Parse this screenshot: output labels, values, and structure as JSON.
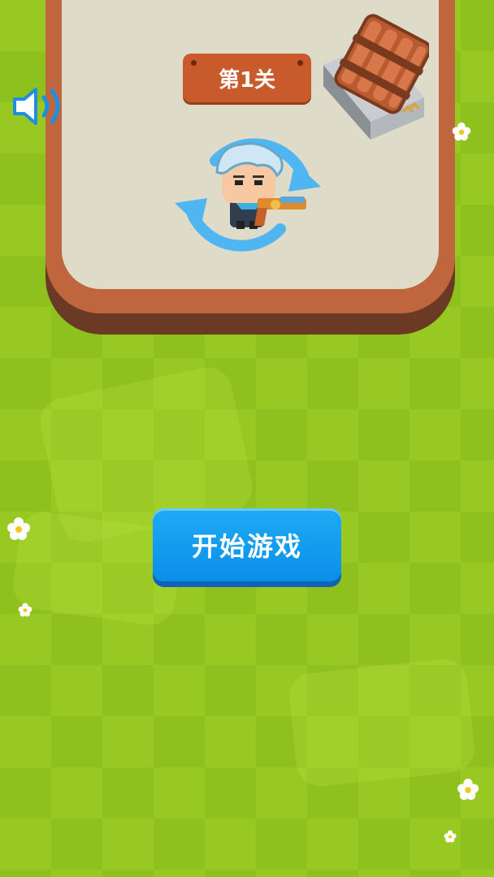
{
  "level": {
    "label": "第1关"
  },
  "start_button": {
    "label": "开始游戏"
  },
  "sound": {
    "icon": "speaker-icon",
    "state": "on"
  },
  "player": {
    "icon": "gunner-hero-icon",
    "weapon": "revolver-icon",
    "indicator": "rotate-arrows-icon"
  },
  "obstacle": {
    "icon": "wooden-crate-icon"
  },
  "colors": {
    "grass": "#97c922",
    "arena_floor": "#dfdbc9",
    "arena_rim": "#c0663e",
    "badge": "#c85a2c",
    "button": "#0a9cf0",
    "rotate_arrows": "#4fb6f2"
  }
}
